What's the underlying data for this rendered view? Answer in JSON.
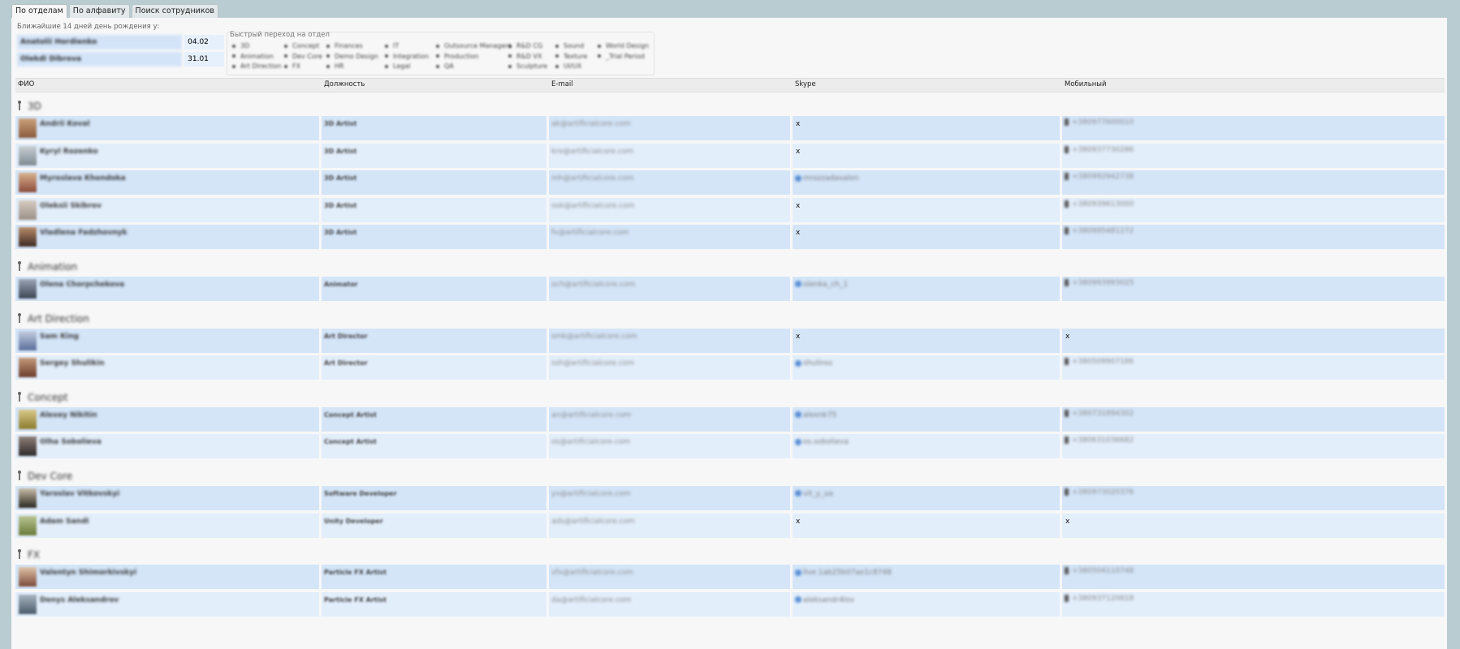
{
  "tabs": [
    {
      "label": "По отделам",
      "active": true
    },
    {
      "label": "По алфавиту",
      "active": false
    },
    {
      "label": "Поиск сотрудников",
      "active": false
    }
  ],
  "birthdays": {
    "title": "Ближайшие 14 дней день рождения у:",
    "items": [
      {
        "name": "Anatolii Hordienko",
        "date": "04.02"
      },
      {
        "name": "Olekdi Dibrova",
        "date": "31.01"
      }
    ]
  },
  "quick_nav": {
    "title": "Быстрый переход на отдел",
    "columns": [
      [
        "3D",
        "Animation",
        "Art Direction"
      ],
      [
        "Concept",
        "Dev Core",
        "FX"
      ],
      [
        "Finances",
        "Demo Design",
        "HR"
      ],
      [
        "IT",
        "Integration",
        "Legal"
      ],
      [
        "Outsource Managers",
        "Production",
        "QA"
      ],
      [
        "R&D CG",
        "R&D VX",
        "Sculpture"
      ],
      [
        "Sound",
        "Texture",
        "UI/UX"
      ],
      [
        "World Design",
        "_Trial Period"
      ]
    ]
  },
  "table": {
    "headers": [
      "ФИО",
      "Должность",
      "E-mail",
      "Skype",
      "Мобильный"
    ],
    "groups": [
      {
        "name": "3D",
        "rows": [
          {
            "name": "Andrii Koval",
            "position": "3D Artist",
            "email": "ak@artificialcore.com",
            "skype": "x",
            "mobile": "+380977600010"
          },
          {
            "name": "Kyryl Rozenko",
            "position": "3D Artist",
            "email": "kro@artificialcore.com",
            "skype": "x",
            "mobile": "+380937730286"
          },
          {
            "name": "Myroslava Khondoka",
            "position": "3D Artist",
            "email": "mh@artificialcore.com",
            "skype": "mrozzadavalon",
            "mobile": "+380992942738"
          },
          {
            "name": "Oleksii Skibrov",
            "position": "3D Artist",
            "email": "osk@artificialcore.com",
            "skype": "x",
            "mobile": "+380939613000"
          },
          {
            "name": "Vladlena Fadzhovnyk",
            "position": "3D Artist",
            "email": "fv@artificialcore.com",
            "skype": "x",
            "mobile": "+380995481272"
          }
        ]
      },
      {
        "name": "Animation",
        "rows": [
          {
            "name": "Olena Chorpchekova",
            "position": "Animator",
            "email": "och@artificialcore.com",
            "skype": "olenka_ch_1",
            "mobile": "+380993993025"
          }
        ]
      },
      {
        "name": "Art Direction",
        "rows": [
          {
            "name": "Sam King",
            "position": "Art Director",
            "email": "smk@artificialcore.com",
            "skype": "x",
            "mobile": "x"
          },
          {
            "name": "Sergey Shulikin",
            "position": "Art Director",
            "email": "ssh@artificialcore.com",
            "skype": "shulinss",
            "mobile": "+380509907186"
          }
        ]
      },
      {
        "name": "Concept",
        "rows": [
          {
            "name": "Alexey Nikitin",
            "position": "Concept Artist",
            "email": "an@artificialcore.com",
            "skype": "alexnk75",
            "mobile": "+380731894302"
          },
          {
            "name": "Olha Sobolieva",
            "position": "Concept Artist",
            "email": "os@artificialcore.com",
            "skype": "os.sobolieva",
            "mobile": "+380631036682"
          }
        ]
      },
      {
        "name": "Dev Core",
        "rows": [
          {
            "name": "Yaroslav Vitkovskyi",
            "position": "Software Developer",
            "email": "yv@artificialcore.com",
            "skype": "vit_y_ua",
            "mobile": "+380973020376"
          },
          {
            "name": "Adam Sandi",
            "position": "Unity Developer",
            "email": "ads@artificialcore.com",
            "skype": "x",
            "mobile": "x"
          }
        ]
      },
      {
        "name": "FX",
        "rows": [
          {
            "name": "Valentyn Shimorkivskyi",
            "position": "Particle FX Artist",
            "email": "vfx@artificialcore.com",
            "skype": "live.1ab25b07ae1c8748",
            "mobile": "+380504110748"
          },
          {
            "name": "Denys Aleksandrov",
            "position": "Particle FX Artist",
            "email": "da@artificialcore.com",
            "skype": "aleksandr4lov",
            "mobile": "+380937120818"
          }
        ]
      }
    ]
  }
}
